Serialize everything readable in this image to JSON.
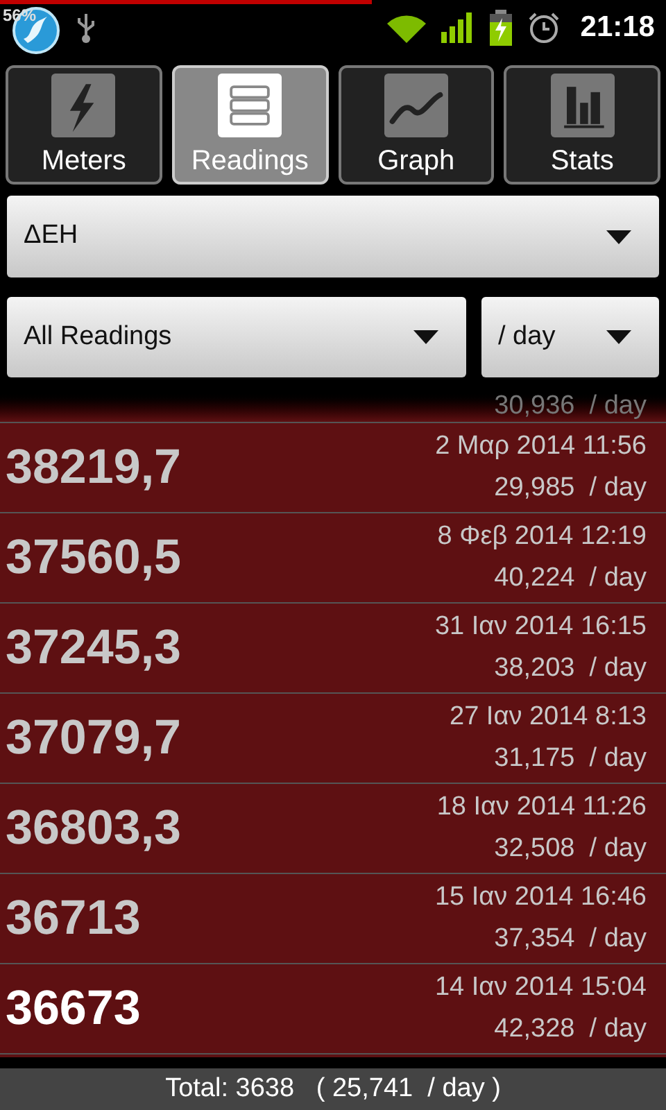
{
  "status_bar": {
    "progress": {
      "label": "56%"
    },
    "time": "21:18"
  },
  "tabs": [
    {
      "label": "Meters",
      "kind": "bolt",
      "selected": false
    },
    {
      "label": "Readings",
      "kind": "list",
      "selected": true
    },
    {
      "label": "Graph",
      "kind": "line",
      "selected": false
    },
    {
      "label": "Stats",
      "kind": "bars",
      "selected": false
    }
  ],
  "meter_spinner": {
    "value": "ΔΕΗ"
  },
  "filter_spinner": {
    "value": "All Readings"
  },
  "unit_spinner": {
    "value": "/ day"
  },
  "partial_row": {
    "per_day": "30,936  / day"
  },
  "readings": [
    {
      "value": "38219,7",
      "date": "2 Μαρ 2014 11:56",
      "per_day": "29,985  / day",
      "emphasized": false
    },
    {
      "value": "37560,5",
      "date": "8 Φεβ 2014 12:19",
      "per_day": "40,224  / day",
      "emphasized": false
    },
    {
      "value": "37245,3",
      "date": "31 Ιαν 2014 16:15",
      "per_day": "38,203  / day",
      "emphasized": false
    },
    {
      "value": "37079,7",
      "date": "27 Ιαν 2014 8:13",
      "per_day": "31,175  / day",
      "emphasized": false
    },
    {
      "value": "36803,3",
      "date": "18 Ιαν 2014 11:26",
      "per_day": "32,508  / day",
      "emphasized": false
    },
    {
      "value": "36713",
      "date": "15 Ιαν 2014 16:46",
      "per_day": "37,354  / day",
      "emphasized": false
    },
    {
      "value": "36673",
      "date": "14 Ιαν 2014 15:04",
      "per_day": "42,328  / day",
      "emphasized": true
    }
  ],
  "footer": {
    "total": "Total: 3638   ( 25,741  / day )"
  }
}
